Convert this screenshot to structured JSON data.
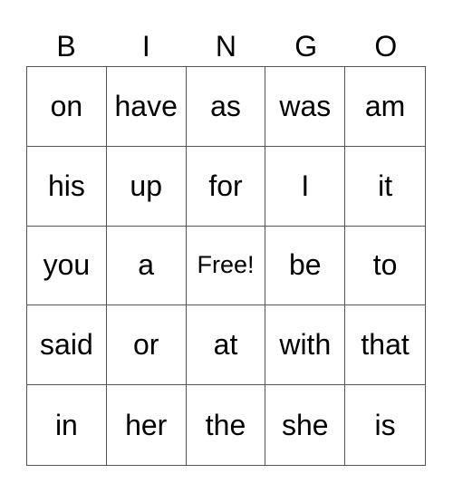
{
  "header": [
    "B",
    "I",
    "N",
    "G",
    "O"
  ],
  "cells": [
    [
      "on",
      "have",
      "as",
      "was",
      "am"
    ],
    [
      "his",
      "up",
      "for",
      "I",
      "it"
    ],
    [
      "you",
      "a",
      "Free!",
      "be",
      "to"
    ],
    [
      "said",
      "or",
      "at",
      "with",
      "that"
    ],
    [
      "in",
      "her",
      "the",
      "she",
      "is"
    ]
  ]
}
